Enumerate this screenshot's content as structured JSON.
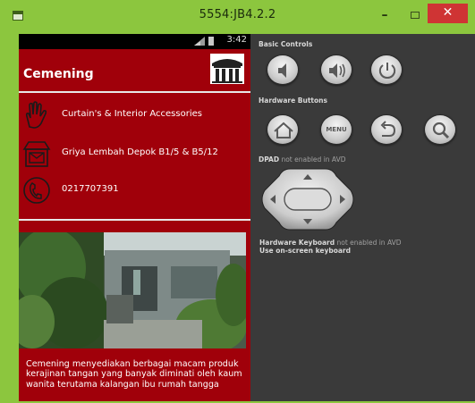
{
  "window": {
    "title": "5554:JB4.2.2",
    "minimize_glyph": "–",
    "close_glyph": "✕"
  },
  "status_bar": {
    "time": "3:42"
  },
  "app": {
    "title": "Cemening",
    "info": [
      {
        "icon": "hand-icon",
        "text": "Curtain's & Interior Accessories"
      },
      {
        "icon": "shop-icon",
        "text": "Griya Lembah Depok B1/5 & B5/12"
      },
      {
        "icon": "phone-icon",
        "text": "0217707391"
      }
    ],
    "description": "Cemening menyediakan berbagai macam produk kerajinan tangan yang banyak diminati oleh kaum wanita terutama kalangan ibu rumah tangga"
  },
  "controls": {
    "basic_label": "Basic Controls",
    "hardware_label": "Hardware Buttons",
    "menu_label": "MENU",
    "dpad_label_bold": "DPAD",
    "dpad_label_rest": " not enabled in AVD",
    "keyboard_bold": "Hardware Keyboard",
    "keyboard_rest": " not enabled in AVD",
    "keyboard_line2": "Use on-screen keyboard"
  },
  "colors": {
    "window_frame": "#8cc63e",
    "app_background": "#a0000a",
    "panel_background": "#3a3a3a",
    "close_button": "#cf3434"
  }
}
